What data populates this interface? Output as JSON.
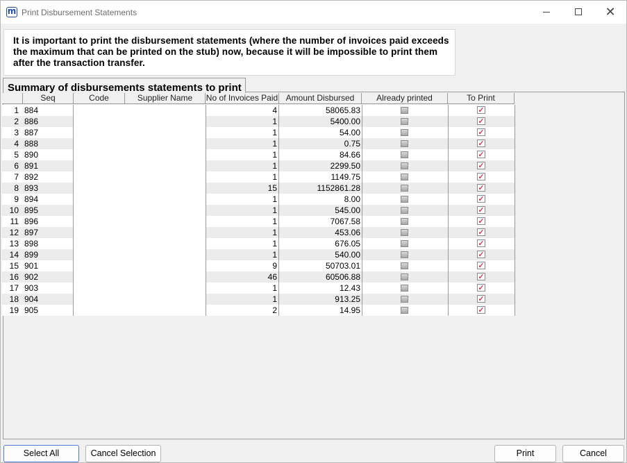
{
  "window": {
    "title": "Print Disbursement Statements",
    "app_icon_glyph": "m"
  },
  "notice": {
    "text": "It is important to print the disbursement statements (where the number of invoices paid exceeds the maximum that can be printed on the stub) now, because it will be impossible to print them after the transaction transfer."
  },
  "summary": {
    "title": "Summary of disbursements statements to print"
  },
  "table": {
    "columns": [
      "Seq",
      "Code",
      "Supplier Name",
      "No of Invoices Paid",
      "Amount Disbursed",
      "Already printed",
      "To Print"
    ],
    "rows": [
      {
        "num": "1",
        "seq": "884",
        "invoices": "4",
        "amount": "58065.83",
        "already_printed": false,
        "to_print": true
      },
      {
        "num": "2",
        "seq": "886",
        "invoices": "1",
        "amount": "5400.00",
        "already_printed": false,
        "to_print": true
      },
      {
        "num": "3",
        "seq": "887",
        "invoices": "1",
        "amount": "54.00",
        "already_printed": false,
        "to_print": true
      },
      {
        "num": "4",
        "seq": "888",
        "invoices": "1",
        "amount": "0.75",
        "already_printed": false,
        "to_print": true
      },
      {
        "num": "5",
        "seq": "890",
        "invoices": "1",
        "amount": "84.66",
        "already_printed": false,
        "to_print": true
      },
      {
        "num": "6",
        "seq": "891",
        "invoices": "1",
        "amount": "2299.50",
        "already_printed": false,
        "to_print": true
      },
      {
        "num": "7",
        "seq": "892",
        "invoices": "1",
        "amount": "1149.75",
        "already_printed": false,
        "to_print": true
      },
      {
        "num": "8",
        "seq": "893",
        "invoices": "15",
        "amount": "1152861.28",
        "already_printed": false,
        "to_print": true
      },
      {
        "num": "9",
        "seq": "894",
        "invoices": "1",
        "amount": "8.00",
        "already_printed": false,
        "to_print": true
      },
      {
        "num": "10",
        "seq": "895",
        "invoices": "1",
        "amount": "545.00",
        "already_printed": false,
        "to_print": true
      },
      {
        "num": "11",
        "seq": "896",
        "invoices": "1",
        "amount": "7067.58",
        "already_printed": false,
        "to_print": true
      },
      {
        "num": "12",
        "seq": "897",
        "invoices": "1",
        "amount": "453.06",
        "already_printed": false,
        "to_print": true
      },
      {
        "num": "13",
        "seq": "898",
        "invoices": "1",
        "amount": "676.05",
        "already_printed": false,
        "to_print": true
      },
      {
        "num": "14",
        "seq": "899",
        "invoices": "1",
        "amount": "540.00",
        "already_printed": false,
        "to_print": true
      },
      {
        "num": "15",
        "seq": "901",
        "invoices": "9",
        "amount": "50703.01",
        "already_printed": false,
        "to_print": true
      },
      {
        "num": "16",
        "seq": "902",
        "invoices": "46",
        "amount": "60506.88",
        "already_printed": false,
        "to_print": true
      },
      {
        "num": "17",
        "seq": "903",
        "invoices": "1",
        "amount": "12.43",
        "already_printed": false,
        "to_print": true
      },
      {
        "num": "18",
        "seq": "904",
        "invoices": "1",
        "amount": "913.25",
        "already_printed": false,
        "to_print": true
      },
      {
        "num": "19",
        "seq": "905",
        "invoices": "2",
        "amount": "14.95",
        "already_printed": false,
        "to_print": true
      }
    ]
  },
  "buttons": {
    "select_all": "Select All",
    "cancel_selection": "Cancel Selection",
    "print": "Print",
    "cancel": "Cancel"
  },
  "colors": {
    "check_mark": "#d00000",
    "focus_border": "#4e7bd6"
  }
}
